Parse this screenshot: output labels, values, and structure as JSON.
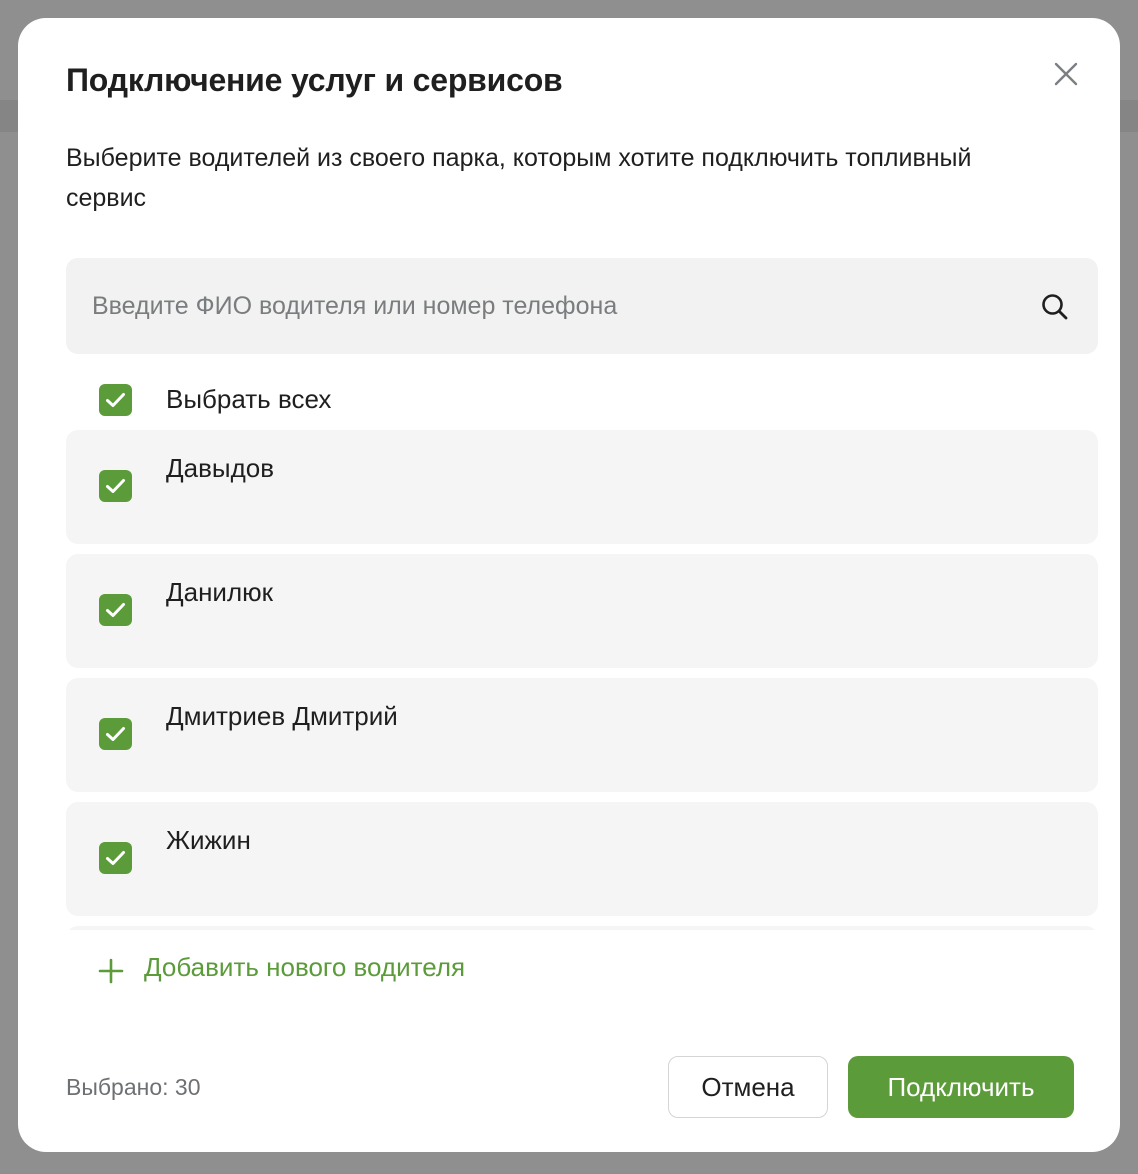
{
  "modal": {
    "title": "Подключение услуг и сервисов",
    "subtitle": "Выберите водителей из своего парка, которым хотите подключить топливный сервис",
    "close_icon": "close-icon"
  },
  "search": {
    "placeholder": "Введите ФИО водителя или номер телефона",
    "value": "",
    "icon": "search-icon"
  },
  "select_all": {
    "label": "Выбрать всех",
    "checked": true
  },
  "drivers": [
    {
      "name": "Давыдов",
      "checked": true
    },
    {
      "name": "Данилюк",
      "checked": true
    },
    {
      "name": "Дмитриев Дмитрий",
      "checked": true
    },
    {
      "name": "Жижин",
      "checked": true
    }
  ],
  "add_driver": {
    "label": "Добавить нового водителя",
    "icon": "plus-icon"
  },
  "footer": {
    "selected_count": "Выбрано: 30",
    "cancel_label": "Отмена",
    "connect_label": "Подключить"
  },
  "colors": {
    "accent": "#5c9b3a",
    "card_background": "#f4f5f4",
    "search_background": "#f1f2f1",
    "overlay": "#8f8f8f"
  }
}
